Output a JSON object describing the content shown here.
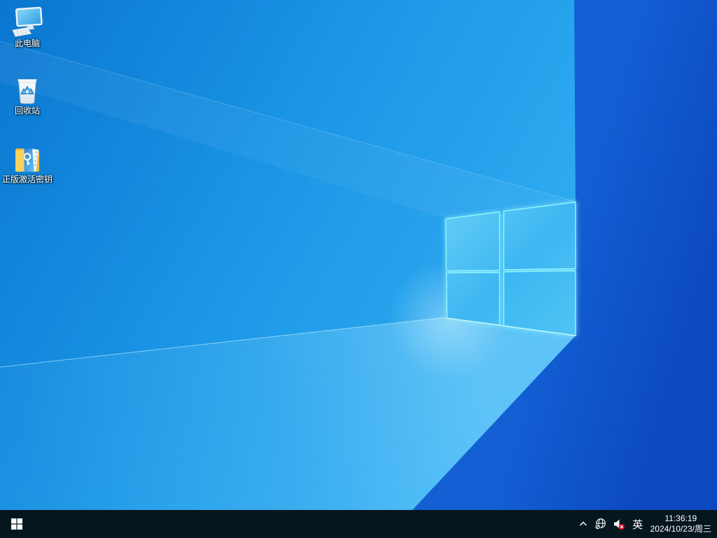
{
  "desktop": {
    "icons": [
      {
        "label": "此电脑",
        "icon": "this-pc-icon"
      },
      {
        "label": "回收站",
        "icon": "recycle-bin-icon"
      },
      {
        "label": "正版激活密钥",
        "icon": "folder-activation-key-icon"
      }
    ],
    "wallpaper_logo": "windows-10-light-flag"
  },
  "taskbar": {
    "start_icon": "windows-start-icon",
    "tray": {
      "hidden_icons": "chevron-up-icon",
      "network": "globe-no-internet-icon",
      "volume": "speaker-muted-icon",
      "ime_indicator": "英",
      "clock": {
        "time": "11:36:19",
        "date": "2024/10/23/周三"
      }
    }
  },
  "colors": {
    "taskbar_bg": "#05161f",
    "wallpaper_bright": "#2aa4ee",
    "wallpaper_dark": "#0c49bf",
    "logo_pane": "#4cc2f4",
    "logo_edge": "#8df2ff",
    "mute_badge_red": "#e81123",
    "icon_label_text": "#ffffff"
  }
}
